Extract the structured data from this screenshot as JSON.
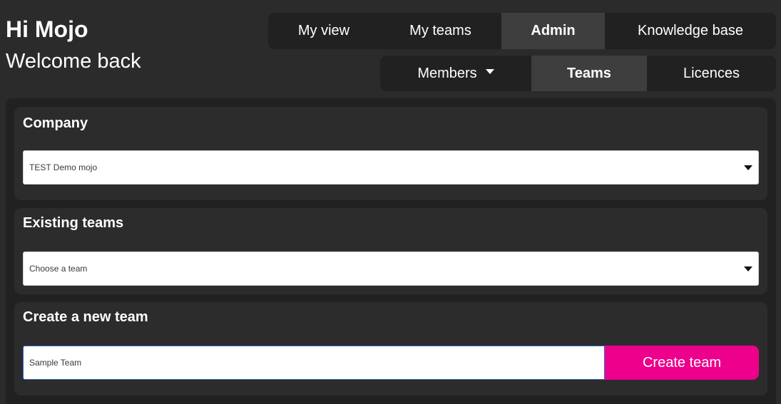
{
  "greeting": {
    "title": "Hi Mojo",
    "subtitle": "Welcome back"
  },
  "top_nav": {
    "tabs": [
      {
        "label": "My view",
        "active": false
      },
      {
        "label": "My teams",
        "active": false
      },
      {
        "label": "Admin",
        "active": true
      },
      {
        "label": "Knowledge base",
        "active": false
      }
    ]
  },
  "sub_nav": {
    "tabs": [
      {
        "label": "Members",
        "active": false,
        "has_dropdown": true
      },
      {
        "label": "Teams",
        "active": true
      },
      {
        "label": "Licences",
        "active": false
      }
    ]
  },
  "company": {
    "heading": "Company",
    "selected": "TEST Demo mojo"
  },
  "existing_teams": {
    "heading": "Existing teams",
    "placeholder": "Choose a team"
  },
  "create_team": {
    "heading": "Create a new team",
    "input_value": "Sample Team",
    "button_label": "Create team",
    "button_color": "#ec008c"
  },
  "icons": [
    "caret-down-icon",
    "select-arrow-icon"
  ]
}
